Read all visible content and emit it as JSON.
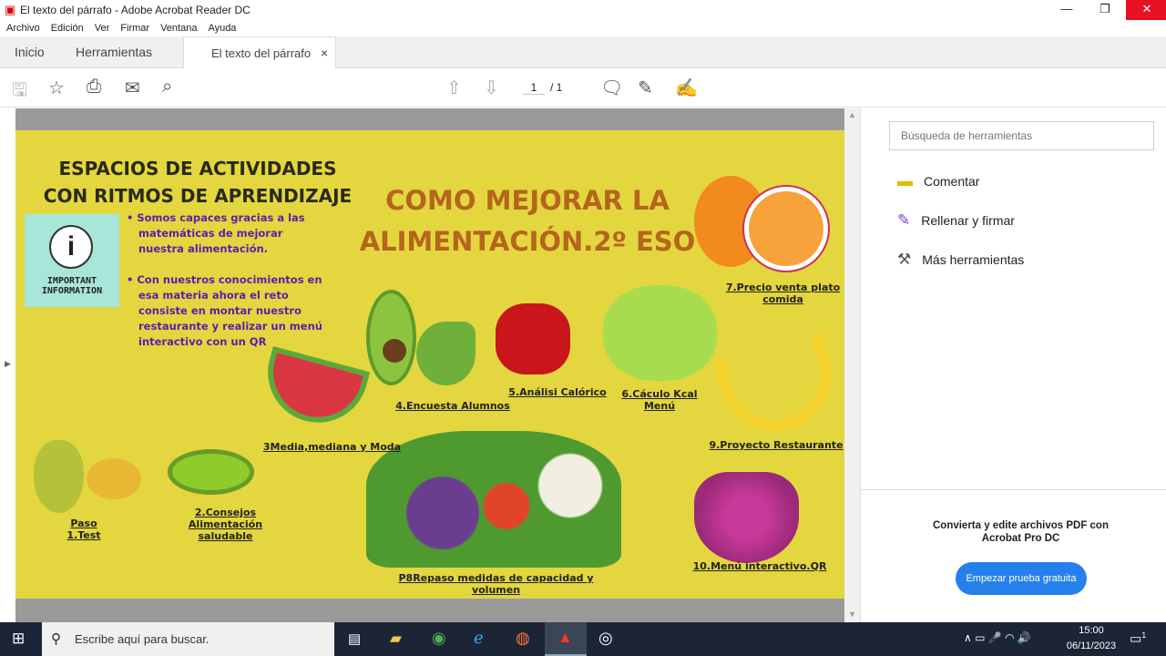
{
  "window": {
    "title": "El texto del párrafo - Adobe Acrobat Reader DC",
    "minimize": "—",
    "restore": "❐",
    "close": "✕"
  },
  "menu": [
    "Archivo",
    "Edición",
    "Ver",
    "Firmar",
    "Ventana",
    "Ayuda"
  ],
  "tabs": {
    "home": "Inicio",
    "tools": "Herramientas",
    "doc": "El texto del párrafo",
    "close": "×"
  },
  "toolbar": {
    "page_current": "1",
    "page_sep": "/ 1"
  },
  "document": {
    "heading": "ESPACIOS DE ACTIVIDADES CON RITMOS DE APRENDIZAJE",
    "info_label": "IMPORTANT INFORMATION",
    "bullets": [
      "Somos capaces gracias a las matemáticas de mejorar nuestra alimentación.",
      "Con nuestros conocimientos en esa materia ahora el  reto consiste en montar nuestro restaurante  y realizar un menú interactivo con un QR"
    ],
    "title": "COMO MEJORAR LA ALIMENTACIÓN.2º ESO",
    "labels": {
      "p1": "Paso 1.Test",
      "p2": "2.Consejos Alimentación saludable",
      "p3": "3Media,mediana y Moda",
      "p4": "4.Encuesta Alumnos",
      "p5": "5.Análisi Calórico",
      "p6": "6.Cáculo Kcal Menú",
      "p7": "7.Precio venta plato comida",
      "p8": "P8Repaso medidas de capacidad y volumen",
      "p9": "9.Proyecto Restaurante",
      "p10": "10.Menú interactivo.QR"
    },
    "colors": {
      "background": "#e3d63f",
      "title": "#b5651d",
      "bullets": "#5b1fa8"
    }
  },
  "right_panel": {
    "search_placeholder": "Búsqueda de herramientas",
    "tools": [
      "Comentar",
      "Rellenar y firmar",
      "Más herramientas"
    ],
    "promo": "Convierta y edite archivos PDF con Acrobat Pro DC",
    "cta": "Empezar prueba gratuita"
  },
  "taskbar": {
    "search_placeholder": "Escribe aquí para buscar.",
    "time": "15:00",
    "date": "06/11/2023",
    "notifications": "1"
  }
}
